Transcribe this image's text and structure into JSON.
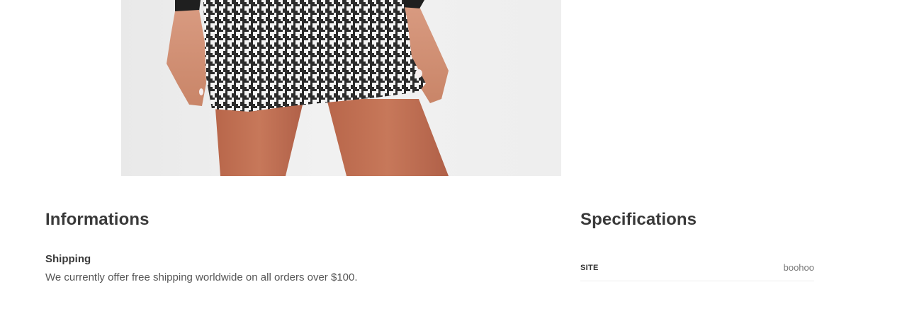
{
  "product_photo": {
    "alt": "Houndstooth mini skirt on model"
  },
  "informations": {
    "title": "Informations",
    "shipping_label": "Shipping",
    "shipping_text": "We currently offer free shipping worldwide on all orders over $100."
  },
  "specifications": {
    "title": "Specifications",
    "rows": [
      {
        "key": "SITE",
        "value": "boohoo"
      }
    ]
  }
}
